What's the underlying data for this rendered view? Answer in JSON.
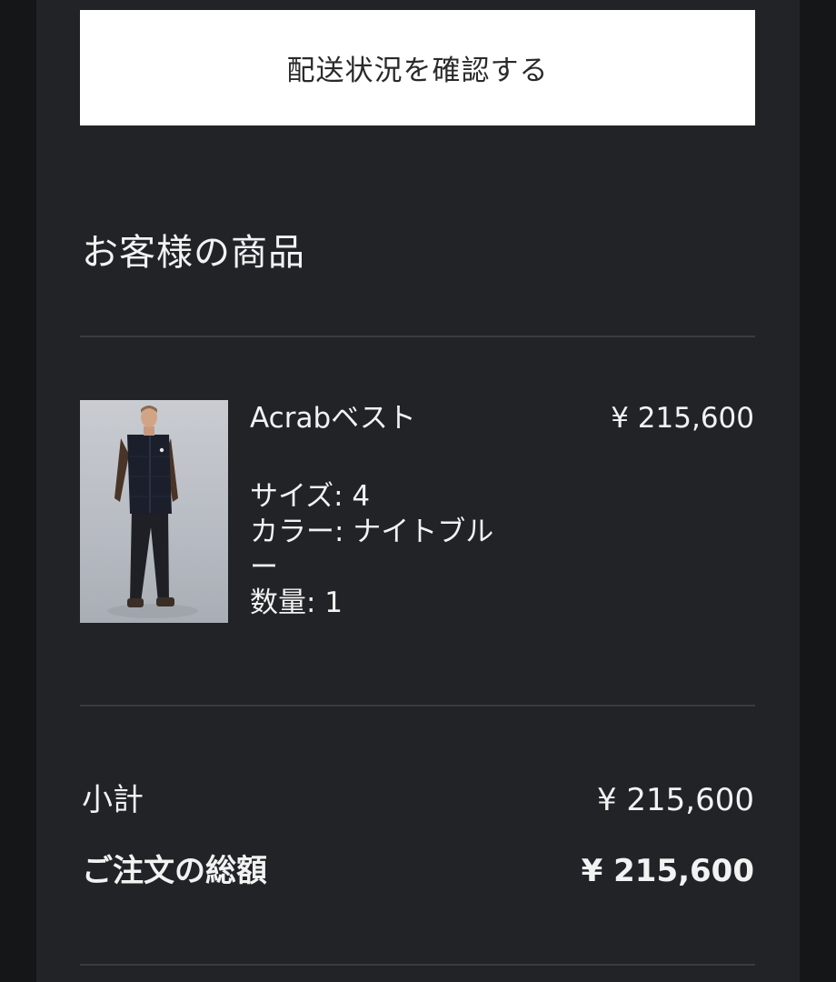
{
  "actions": {
    "track_shipment_label": "配送状況を確認する"
  },
  "order": {
    "section_title": "お客様の商品",
    "items": [
      {
        "name": "Acrabベスト",
        "price": "¥ 215,600",
        "size": "サイズ: 4",
        "color": "カラー: ナイトブルー",
        "quantity": "数量: 1"
      }
    ]
  },
  "summary": {
    "subtotal_label": "小計",
    "subtotal_value": "¥ 215,600",
    "total_label": "ご注文の総額",
    "total_value": "¥ 215,600"
  },
  "colors": {
    "background": "#222327",
    "outer_background": "#151618",
    "button_background": "#ffffff",
    "text": "#f2f2f2",
    "divider": "#3b3c41"
  }
}
